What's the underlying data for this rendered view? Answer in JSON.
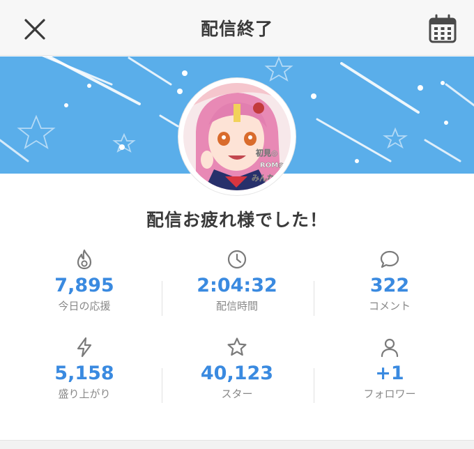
{
  "header": {
    "title": "配信終了",
    "close_icon": "close-icon",
    "calendar_icon": "calendar-icon"
  },
  "banner": {
    "color": "#5aaeea"
  },
  "avatar": {
    "overlay_lines": [
      "初見◎",
      "ROM◎",
      "みんな大"
    ]
  },
  "message": "配信お疲れ様でした！",
  "stats": [
    {
      "icon": "fire-icon",
      "value": "7,895",
      "label": "今日の応援"
    },
    {
      "icon": "clock-icon",
      "value": "2:04:32",
      "label": "配信時間"
    },
    {
      "icon": "comment-icon",
      "value": "322",
      "label": "コメント"
    },
    {
      "icon": "lightning-icon",
      "value": "5,158",
      "label": "盛り上がり"
    },
    {
      "icon": "star-icon",
      "value": "40,123",
      "label": "スター"
    },
    {
      "icon": "person-icon",
      "value": "+1",
      "label": "フォロワー"
    }
  ],
  "colors": {
    "accent": "#3a8ae0",
    "icon": "#7a7a7a",
    "text": "#3a3a3a",
    "label": "#888888"
  }
}
